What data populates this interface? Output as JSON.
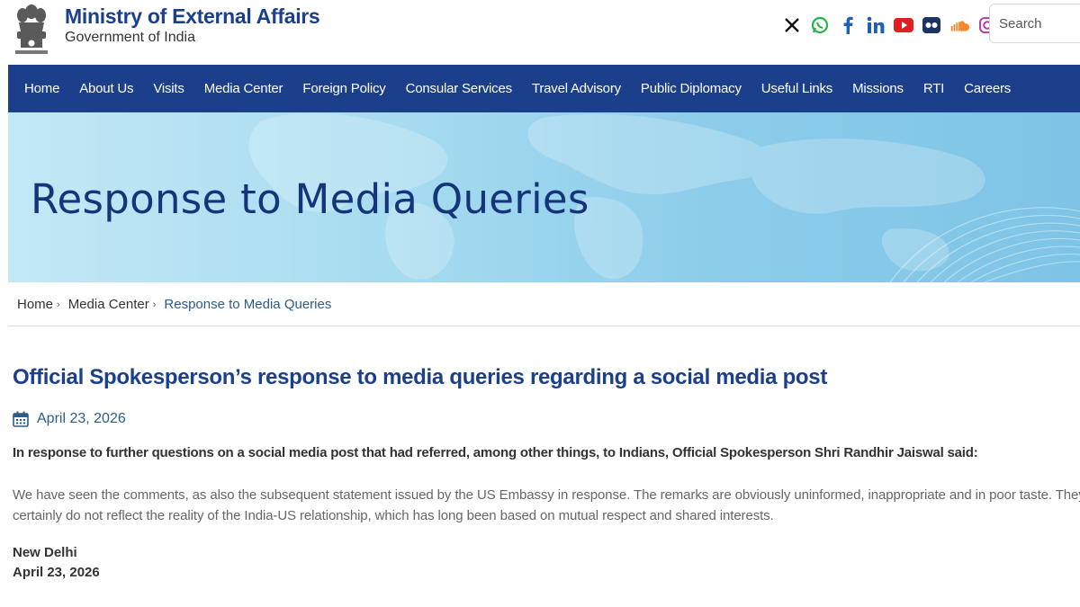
{
  "header": {
    "title": "Ministry of External Affairs",
    "subtitle": "Government of India",
    "emblem_motto": "सत्यमेव जयते",
    "social_icons": [
      "x-icon",
      "whatsapp-icon",
      "facebook-icon",
      "linkedin-icon",
      "youtube-icon",
      "flickr-icon",
      "soundcloud-icon",
      "instagram-icon"
    ],
    "search_placeholder": "Search"
  },
  "nav": {
    "items": [
      "Home",
      "About Us",
      "Visits",
      "Media Center",
      "Foreign Policy",
      "Consular Services",
      "Travel Advisory",
      "Public Diplomacy",
      "Useful Links",
      "Missions",
      "RTI",
      "Careers"
    ]
  },
  "banner": {
    "title": "Response to Media Queries"
  },
  "breadcrumb": {
    "home": "Home",
    "media_center": "Media Center",
    "current": "Response to Media Queries"
  },
  "article": {
    "title": "Official Spokesperson’s response to media queries regarding a social media post",
    "date": "April 23, 2026",
    "lead": "In response to further questions on a social media post that had referred, among other things, to Indians, Official Spokesperson Shri Randhir Jaiswal said:",
    "body": "We have seen the comments, as also the subsequent statement issued by the US Embassy in response. The remarks are obviously uninformed, inappropriate and in poor taste. They certainly do not reflect the reality of the India-US relationship, which has long been based on mutual respect and shared interests.",
    "place": "New Delhi",
    "sign_date": "April 23, 2026"
  },
  "colors": {
    "brand_blue": "#1c3f8b",
    "link_blue": "#2b5d8c",
    "banner_light": "#c3e8f5",
    "banner_dark": "#7ec4e6"
  }
}
